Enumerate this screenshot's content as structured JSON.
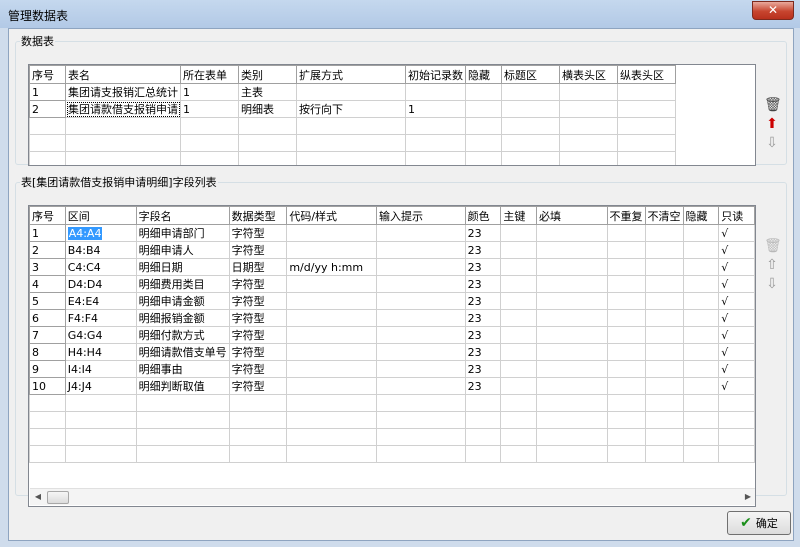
{
  "window": {
    "title": "管理数据表",
    "close_label": "✕"
  },
  "tables_panel": {
    "legend": "数据表",
    "columns": [
      "序号",
      "表名",
      "所在表单",
      "类别",
      "扩展方式",
      "初始记录数",
      "隐藏",
      "标题区",
      "横表头区",
      "纵表头区"
    ],
    "rows": [
      [
        "1",
        "集团请支报销汇总统计",
        "1",
        "主表",
        "",
        "",
        "",
        "",
        "",
        ""
      ],
      [
        "2",
        "集团请款借支报销申请",
        "1",
        "明细表",
        "按行向下",
        "1",
        "",
        "",
        "",
        ""
      ]
    ],
    "icons": [
      "trash-icon",
      "arrow-up-icon",
      "arrow-down-icon"
    ]
  },
  "fields_panel": {
    "legend": "表[集团请款借支报销申请明细]字段列表",
    "columns": [
      "序号",
      "区间",
      "字段名",
      "数据类型",
      "代码/样式",
      "输入提示",
      "颜色",
      "主键",
      "必填",
      "不重复",
      "不清空",
      "隐藏",
      "只读"
    ],
    "rows": [
      [
        "1",
        "A4:A4",
        "明细申请部门",
        "字符型",
        "",
        "",
        "23",
        "",
        "",
        "",
        "",
        "",
        "√"
      ],
      [
        "2",
        "B4:B4",
        "明细申请人",
        "字符型",
        "",
        "",
        "23",
        "",
        "",
        "",
        "",
        "",
        "√"
      ],
      [
        "3",
        "C4:C4",
        "明细日期",
        "日期型",
        "m/d/yy h:mm",
        "",
        "23",
        "",
        "",
        "",
        "",
        "",
        "√"
      ],
      [
        "4",
        "D4:D4",
        "明细费用类目",
        "字符型",
        "",
        "",
        "23",
        "",
        "",
        "",
        "",
        "",
        "√"
      ],
      [
        "5",
        "E4:E4",
        "明细申请金额",
        "字符型",
        "",
        "",
        "23",
        "",
        "",
        "",
        "",
        "",
        "√"
      ],
      [
        "6",
        "F4:F4",
        "明细报销金额",
        "字符型",
        "",
        "",
        "23",
        "",
        "",
        "",
        "",
        "",
        "√"
      ],
      [
        "7",
        "G4:G4",
        "明细付款方式",
        "字符型",
        "",
        "",
        "23",
        "",
        "",
        "",
        "",
        "",
        "√"
      ],
      [
        "8",
        "H4:H4",
        "明细请款借支单号",
        "字符型",
        "",
        "",
        "23",
        "",
        "",
        "",
        "",
        "",
        "√"
      ],
      [
        "9",
        "I4:I4",
        "明细事由",
        "字符型",
        "",
        "",
        "23",
        "",
        "",
        "",
        "",
        "",
        "√"
      ],
      [
        "10",
        "J4:J4",
        "明细判断取值",
        "字符型",
        "",
        "",
        "23",
        "",
        "",
        "",
        "",
        "",
        "√"
      ]
    ],
    "icons": [
      "trash-icon",
      "arrow-up-icon",
      "arrow-down-icon"
    ]
  },
  "ok_button": {
    "label": "确定"
  },
  "colors": {
    "selection": "#3399ff",
    "arrow_active": "#cc0000",
    "ok_check": "#1a8f1a"
  }
}
